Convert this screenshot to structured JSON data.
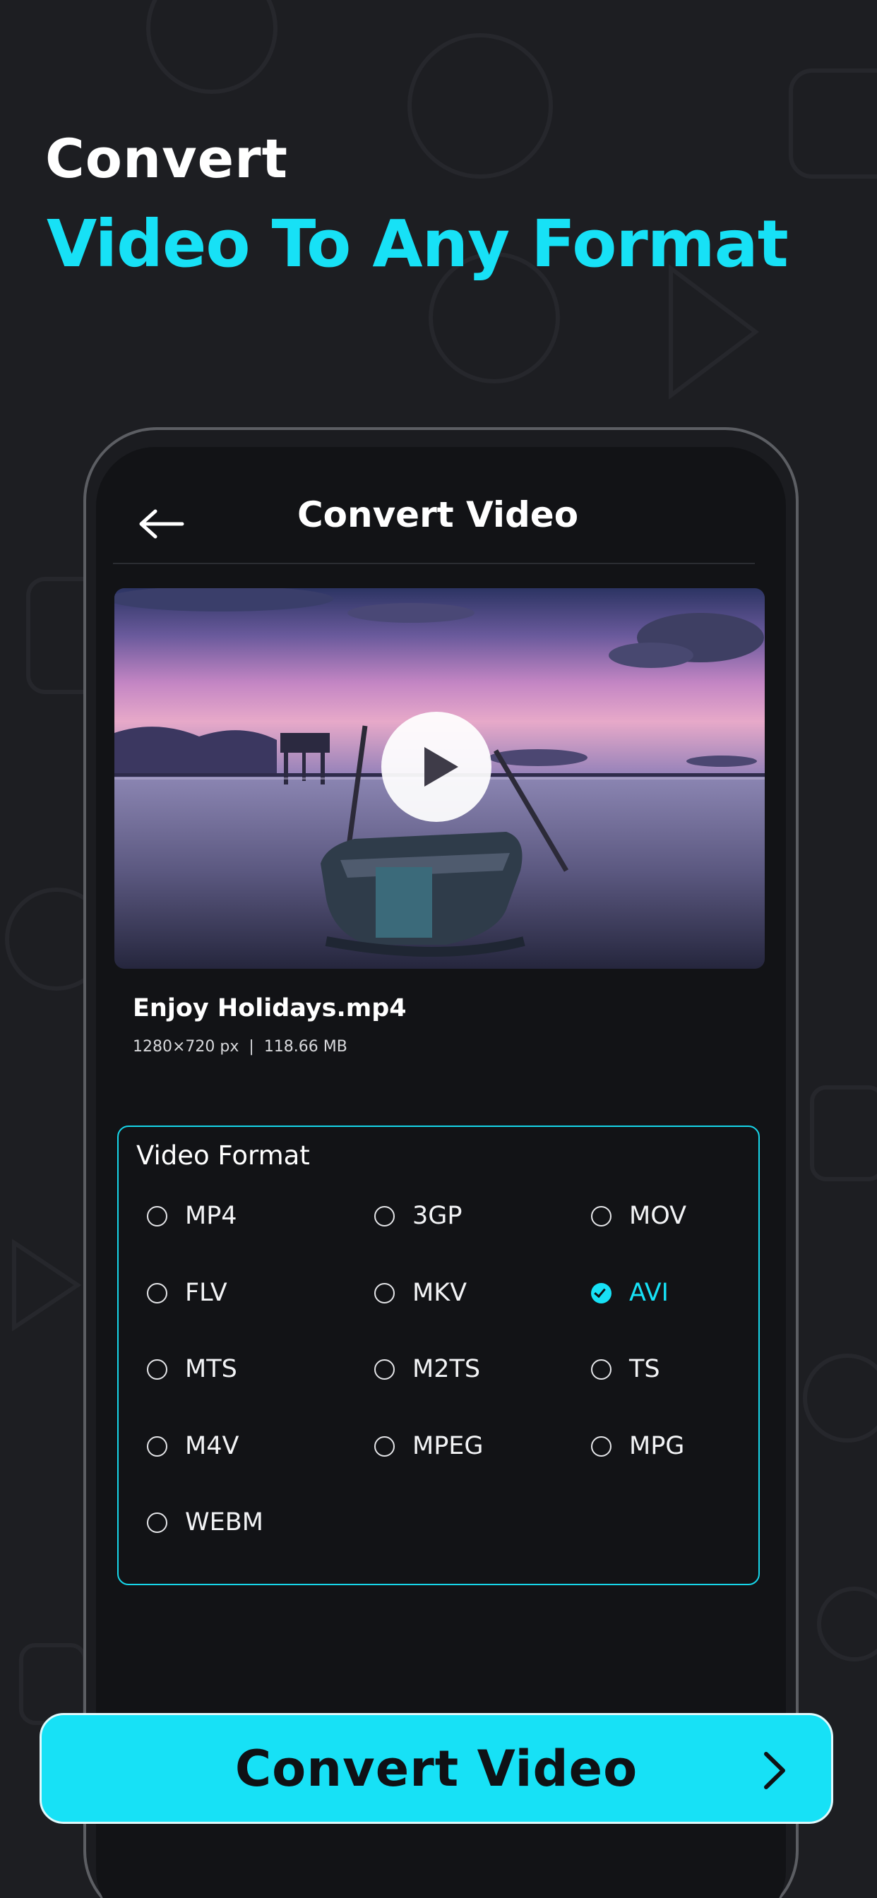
{
  "hero": {
    "line1": "Convert",
    "line2": "Video To Any Format"
  },
  "screen": {
    "back_icon": "arrow-left-icon",
    "title": "Convert Video"
  },
  "video": {
    "play_icon": "play-icon",
    "file_name": "Enjoy Holidays.mp4",
    "resolution": "1280×720 px",
    "separator": "|",
    "size": "118.66 MB"
  },
  "format_panel": {
    "title": "Video Format",
    "selected": "AVI",
    "options": [
      "MP4",
      "3GP",
      "MOV",
      "FLV",
      "MKV",
      "AVI",
      "MTS",
      "M2TS",
      "TS",
      "M4V",
      "MPEG",
      "MPG",
      "WEBM"
    ]
  },
  "cta": {
    "label": "Convert Video",
    "icon": "chevron-right-icon"
  },
  "colors": {
    "accent": "#17e1f6",
    "background": "#1d1e22",
    "screen": "#121316"
  }
}
